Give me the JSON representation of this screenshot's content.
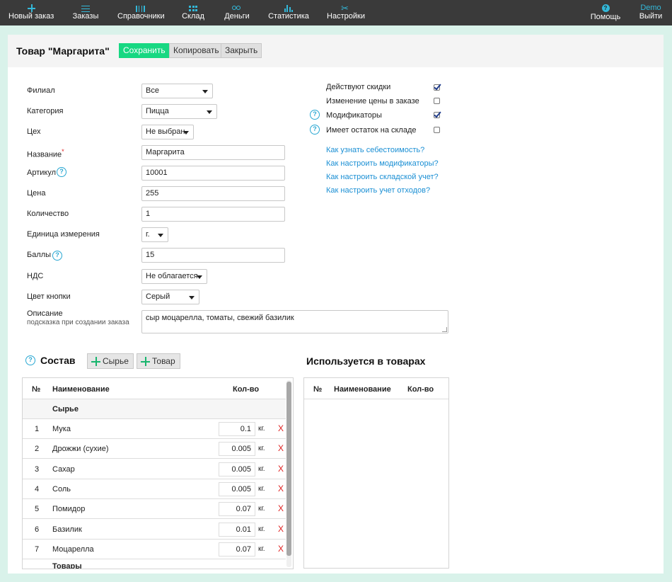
{
  "nav": {
    "items": [
      {
        "label": "Новый заказ",
        "icon": "plus-icon"
      },
      {
        "label": "Заказы",
        "icon": "list-icon"
      },
      {
        "label": "Справочники",
        "icon": "books-icon"
      },
      {
        "label": "Склад",
        "icon": "grid-icon"
      },
      {
        "label": "Деньги",
        "icon": "money-icon"
      },
      {
        "label": "Статистика",
        "icon": "stats-icon"
      },
      {
        "label": "Настройки",
        "icon": "settings-icon"
      }
    ],
    "help_label": "Помощь",
    "help_icon_glyph": "?",
    "user_name": "Demo",
    "logout_label": "Выйти"
  },
  "header": {
    "title": "Товар \"Маргарита\"",
    "save_label": "Сохранить",
    "copy_label": "Копировать",
    "close_label": "Закрыть"
  },
  "form": {
    "branch": {
      "label": "Филиал",
      "value": "Все"
    },
    "category": {
      "label": "Категория",
      "value": "Пицца"
    },
    "workshop": {
      "label": "Цех",
      "value": "Не выбран"
    },
    "name": {
      "label": "Название",
      "required_mark": "*",
      "value": "Маргарита"
    },
    "sku": {
      "label": "Артикул",
      "value": "10001"
    },
    "price": {
      "label": "Цена",
      "value": "255"
    },
    "quantity": {
      "label": "Количество",
      "value": "1"
    },
    "unit": {
      "label": "Единица измерения",
      "value": "г."
    },
    "points": {
      "label": "Баллы",
      "value": "15"
    },
    "vat": {
      "label": "НДС",
      "value": "Не облагается"
    },
    "button_color": {
      "label": "Цвет кнопки",
      "value": "Серый"
    },
    "description": {
      "label": "Описание",
      "hint": "подсказка при создании заказа",
      "value": "сыр моцарелла, томаты, свежий базилик"
    }
  },
  "help_glyph": "?",
  "options": {
    "discounts": {
      "label": "Действуют скидки",
      "checked": true
    },
    "price_change": {
      "label": "Изменение цены в заказе",
      "checked": false
    },
    "modifiers": {
      "label": "Модификаторы",
      "checked": true
    },
    "stock": {
      "label": "Имеет остаток на складе",
      "checked": false
    }
  },
  "links": [
    "Как узнать себестоимость?",
    "Как настроить модификаторы?",
    "Как настроить складской учет?",
    "Как настроить учет отходов?"
  ],
  "composition": {
    "title": "Состав",
    "add_raw_label": "Сырье",
    "add_product_label": "Товар",
    "columns": {
      "num": "№",
      "name": "Наименование",
      "qty": "Кол-во"
    },
    "group_raw": "Сырье",
    "rows": [
      {
        "num": "1",
        "name": "Мука",
        "qty": "0.1",
        "unit": "кг.",
        "delete": "X"
      },
      {
        "num": "2",
        "name": "Дрожжи (сухие)",
        "qty": "0.005",
        "unit": "кг.",
        "delete": "X"
      },
      {
        "num": "3",
        "name": "Сахар",
        "qty": "0.005",
        "unit": "кг.",
        "delete": "X"
      },
      {
        "num": "4",
        "name": "Соль",
        "qty": "0.005",
        "unit": "кг.",
        "delete": "X"
      },
      {
        "num": "5",
        "name": "Помидор",
        "qty": "0.07",
        "unit": "кг.",
        "delete": "X"
      },
      {
        "num": "6",
        "name": "Базилик",
        "qty": "0.01",
        "unit": "кг.",
        "delete": "X"
      },
      {
        "num": "7",
        "name": "Моцарелла",
        "qty": "0.07",
        "unit": "кг.",
        "delete": "X"
      }
    ],
    "group_products_partial": "Товары"
  },
  "used_in": {
    "title": "Используется в товарах",
    "columns": {
      "num": "№",
      "name": "Наименование",
      "qty": "Кол-во"
    }
  }
}
